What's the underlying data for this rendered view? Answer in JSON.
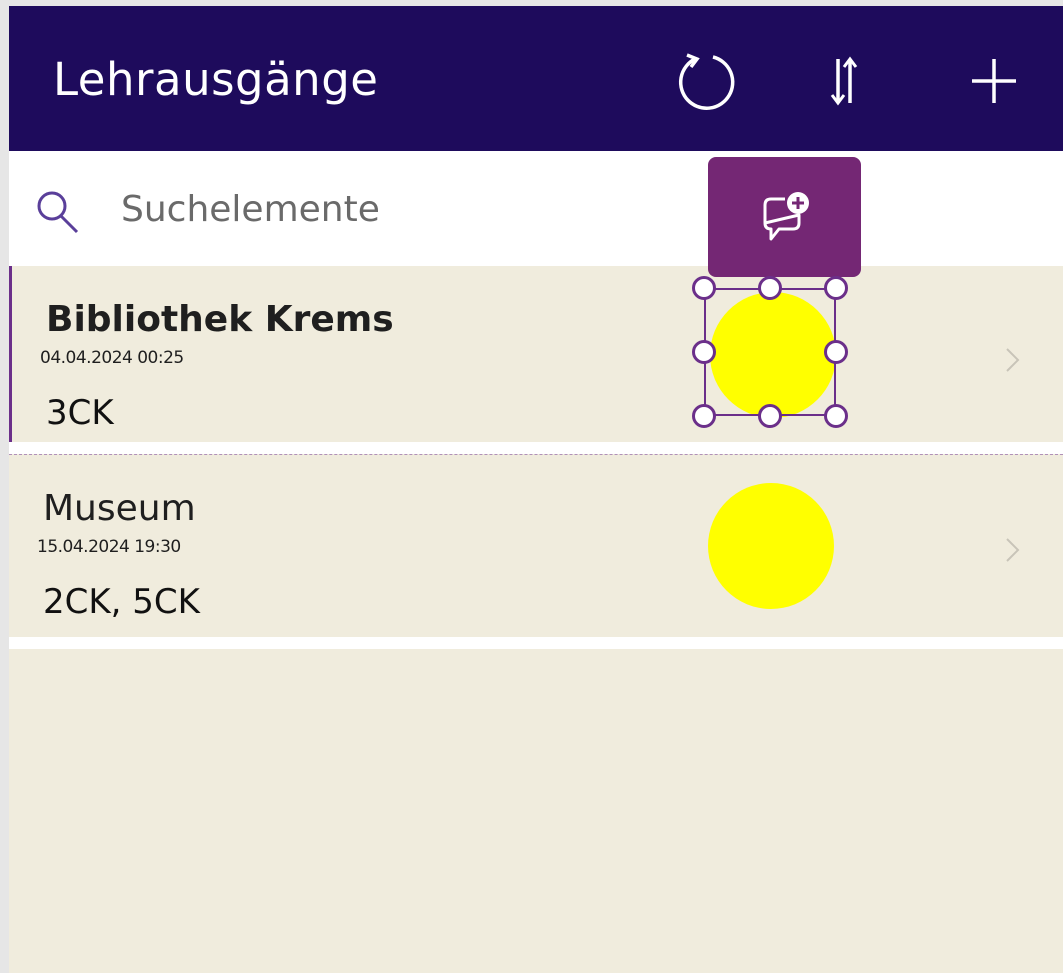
{
  "app": {
    "title": "Lehrausgänge"
  },
  "header": {
    "icons": {
      "refresh": "refresh-icon",
      "sort": "sort-icon",
      "add": "add-icon"
    }
  },
  "search": {
    "placeholder": "Suchelemente",
    "value": ""
  },
  "comment_button": {
    "icon": "add-comment-icon"
  },
  "items": [
    {
      "title": "Bibliothek Krems",
      "date": "04.04.2024 00:25",
      "classes": "3CK",
      "status_color": "#ffff00",
      "selected": true
    },
    {
      "title": "Museum",
      "date": "15.04.2024 19:30",
      "classes": "2CK, 5CK",
      "status_color": "#ffff00",
      "selected": false
    }
  ],
  "colors": {
    "header_bg": "#1e0b5c",
    "accent": "#742774",
    "list_bg": "#f0ecdd",
    "status_yellow": "#ffff00"
  }
}
